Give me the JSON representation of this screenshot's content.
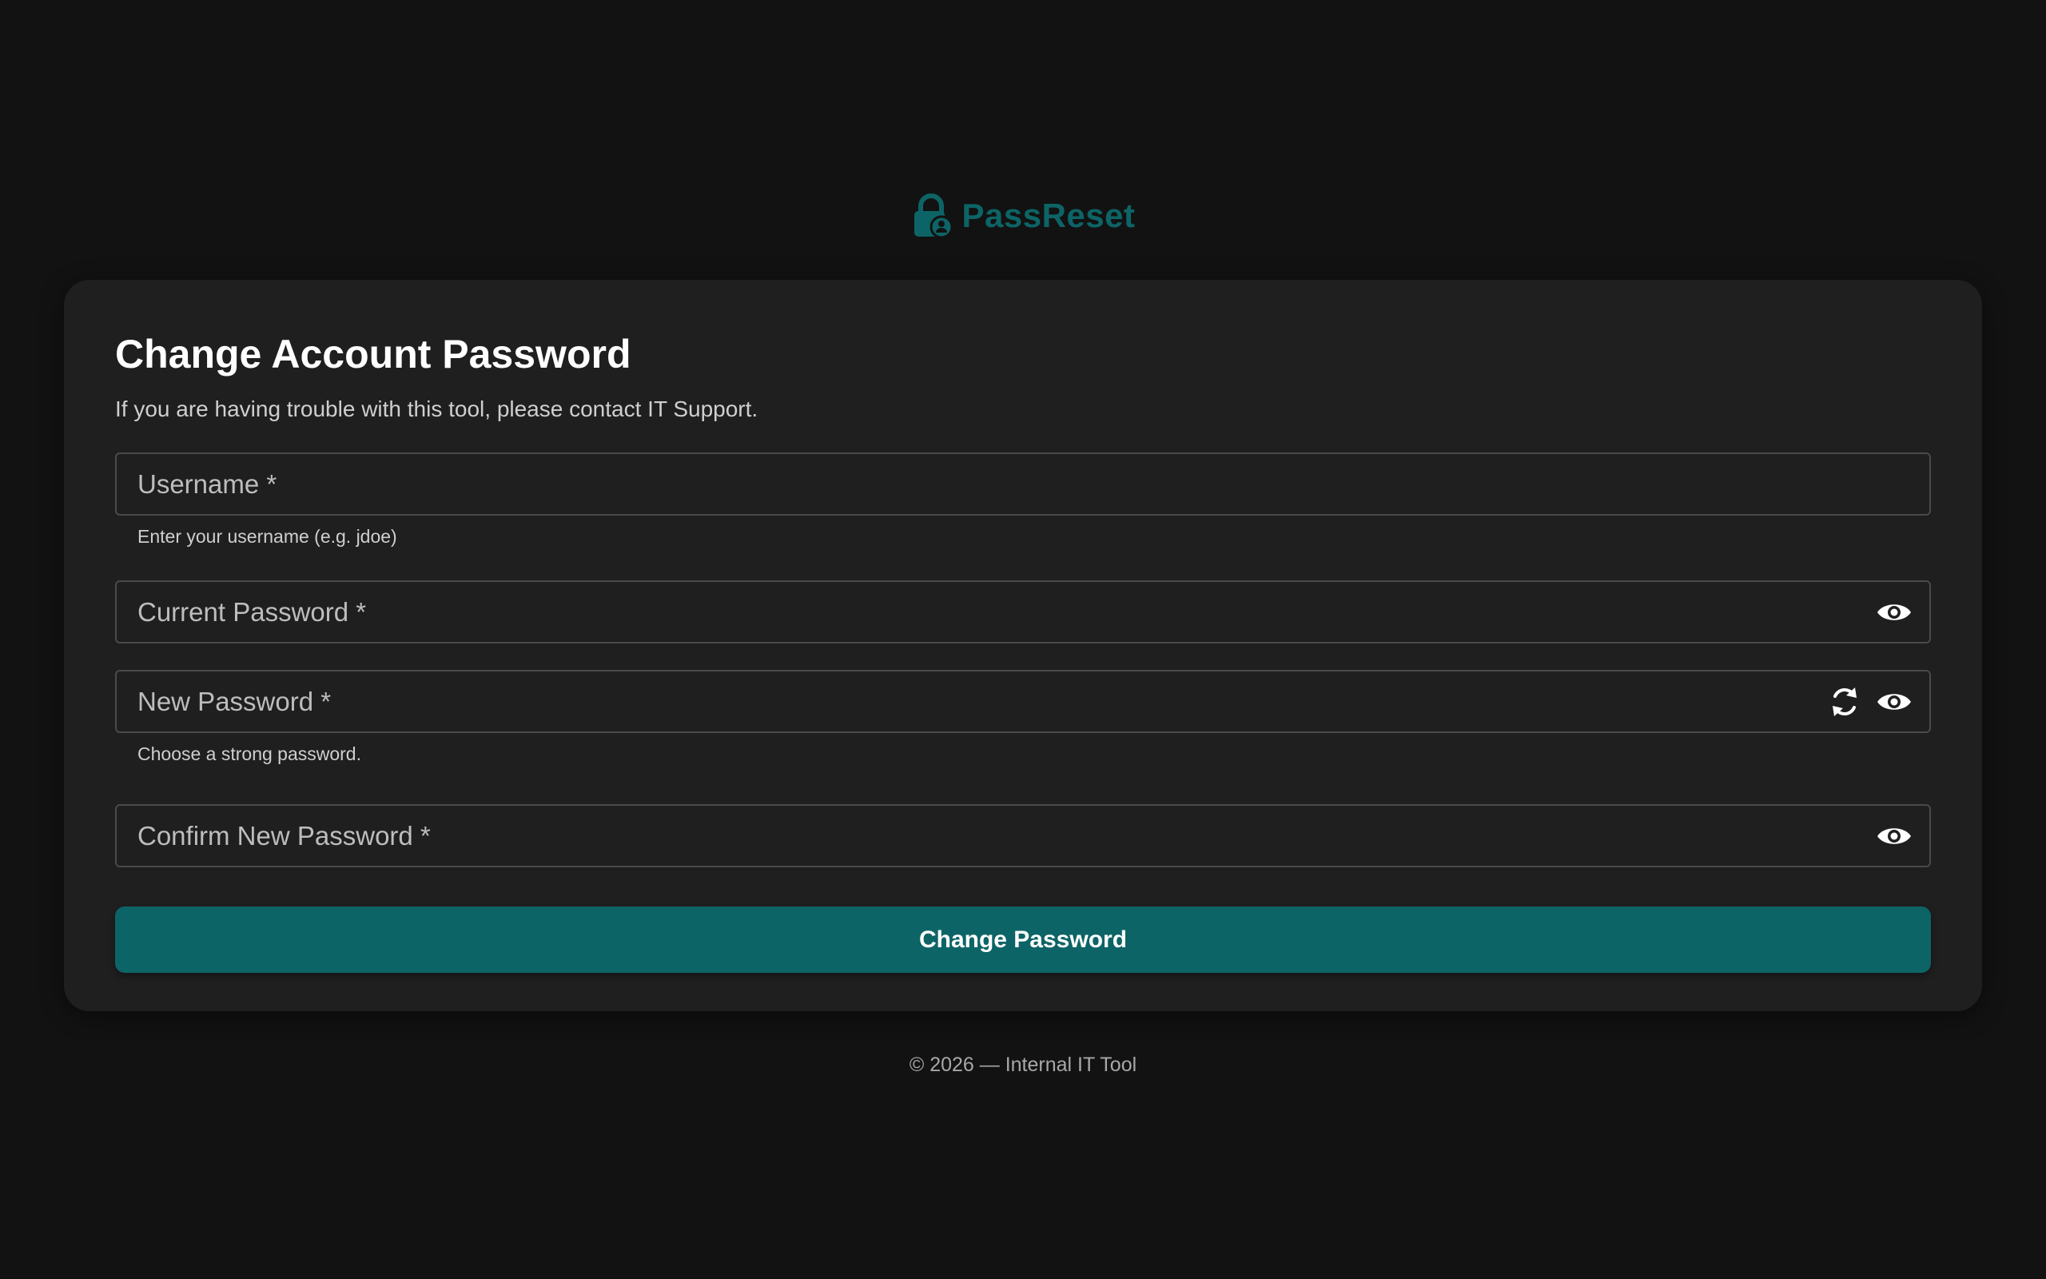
{
  "colors": {
    "accent": "#0d6466",
    "background": "#121212",
    "card": "#1f1f1f"
  },
  "brand": {
    "name": "PassReset",
    "icon": "lock-user-icon"
  },
  "form": {
    "title": "Change Account Password",
    "subtitle": "If you are having trouble with this tool, please contact IT Support.",
    "username": {
      "placeholder": "Username *",
      "value": "",
      "helper": "Enter your username (e.g. jdoe)"
    },
    "current_password": {
      "placeholder": "Current Password *",
      "value": "",
      "icon": "eye-icon"
    },
    "new_password": {
      "placeholder": "New Password *",
      "value": "",
      "helper": "Choose a strong password.",
      "icons": [
        "refresh-icon",
        "eye-icon"
      ]
    },
    "confirm_password": {
      "placeholder": "Confirm New Password *",
      "value": "",
      "icon": "eye-icon"
    },
    "submit_label": "Change Password"
  },
  "footer": {
    "text": "© 2026 — Internal IT Tool"
  }
}
